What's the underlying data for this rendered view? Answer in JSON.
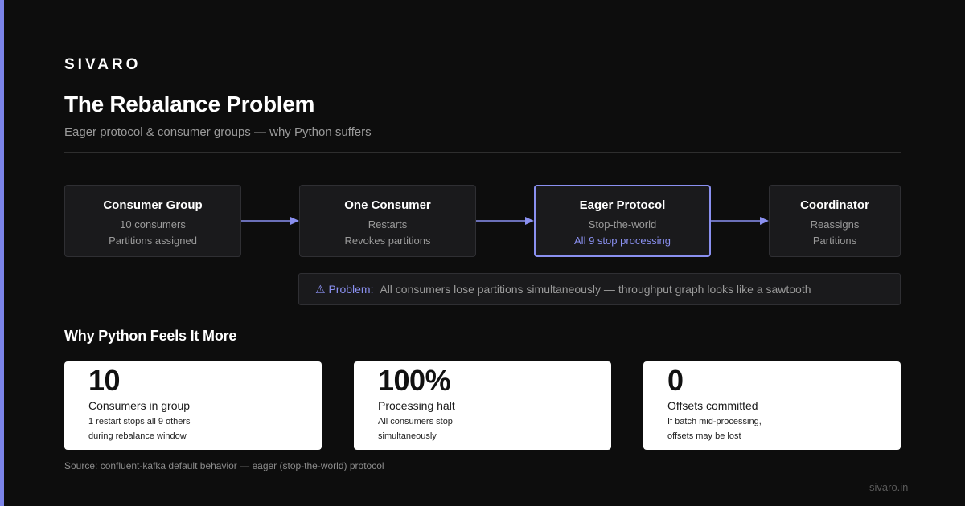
{
  "brand": "SIVARO",
  "title": "The Rebalance Problem",
  "subtitle": "Eager protocol & consumer groups — why Python suffers",
  "flow": [
    {
      "title": "Consumer Group",
      "line1": "10 consumers",
      "line2": "Partitions assigned"
    },
    {
      "title": "One Consumer",
      "line1": "Restarts",
      "line2": "Revokes partitions"
    },
    {
      "title": "Eager Protocol",
      "line1": "Stop-the-world",
      "line2": "All 9 stop processing"
    },
    {
      "title": "Coordinator",
      "line1": "Reassigns",
      "line2": "Partitions"
    }
  ],
  "problem": {
    "label": "⚠ Problem:",
    "text": "All consumers lose partitions simultaneously — throughput graph looks like a sawtooth"
  },
  "section_title": "Why Python Feels It More",
  "stats": [
    {
      "value": "10",
      "label": "Consumers in group",
      "desc1": "1 restart stops all 9 others",
      "desc2": "during rebalance window"
    },
    {
      "value": "100%",
      "label": "Processing halt",
      "desc1": "All consumers stop",
      "desc2": "simultaneously"
    },
    {
      "value": "0",
      "label": "Offsets committed",
      "desc1": "If batch mid-processing,",
      "desc2": "offsets may be lost"
    }
  ],
  "source": "Source: confluent-kafka default behavior — eager (stop-the-world) protocol",
  "footer": "sivaro.in",
  "colors": {
    "accent": "#7b83e8",
    "background": "#0d0d0d",
    "card": "#ffffff"
  }
}
